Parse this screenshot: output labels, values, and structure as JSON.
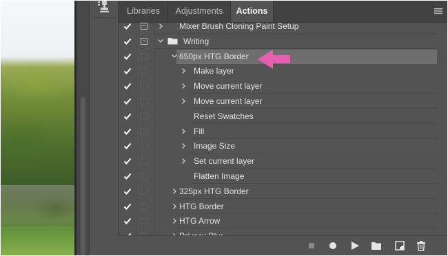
{
  "colors": {
    "panel_bg": "#535353",
    "tab_bar_bg": "#424242",
    "selected_row_bg": "#6e6e6e",
    "annotation_arrow": "#e55fae",
    "text": "#e2e2e2"
  },
  "tabs": [
    {
      "label": "Libraries",
      "active": false
    },
    {
      "label": "Adjustments",
      "active": false
    },
    {
      "label": "Actions",
      "active": true
    }
  ],
  "actions": [
    {
      "label": "Mixer Brush Cloning Paint Setup",
      "level": 0,
      "expander": "collapsed",
      "checked": true,
      "dialog": true
    },
    {
      "label": "Writing",
      "level": 0,
      "expander": "expanded",
      "folder": true,
      "checked": true,
      "dialog": true
    },
    {
      "label": "650px HTG Border",
      "level": 1,
      "expander": "expanded",
      "checked": true,
      "dialog": false,
      "selected": true
    },
    {
      "label": "Make layer",
      "level": 2,
      "expander": "collapsed",
      "checked": true,
      "dialog": false
    },
    {
      "label": "Move current layer",
      "level": 2,
      "expander": "collapsed",
      "checked": true,
      "dialog": false
    },
    {
      "label": "Move current layer",
      "level": 2,
      "expander": "collapsed",
      "checked": true,
      "dialog": false
    },
    {
      "label": "Reset Swatches",
      "level": 2,
      "expander": "none",
      "checked": true,
      "dialog": false
    },
    {
      "label": "Fill",
      "level": 2,
      "expander": "collapsed",
      "checked": true,
      "dialog": false
    },
    {
      "label": "Image Size",
      "level": 2,
      "expander": "collapsed",
      "checked": true,
      "dialog": false
    },
    {
      "label": "Set current layer",
      "level": 2,
      "expander": "collapsed",
      "checked": true,
      "dialog": false
    },
    {
      "label": "Flatten Image",
      "level": 2,
      "expander": "none",
      "checked": true,
      "dialog": false
    },
    {
      "label": "325px HTG Border",
      "level": 1,
      "expander": "collapsed",
      "checked": true,
      "dialog": false
    },
    {
      "label": "HTG Border",
      "level": 1,
      "expander": "collapsed",
      "checked": true,
      "dialog": false
    },
    {
      "label": "HTG Arrow",
      "level": 1,
      "expander": "collapsed",
      "checked": true,
      "dialog": false
    },
    {
      "label": "Privacy Blur",
      "level": 1,
      "expander": "collapsed",
      "checked": true,
      "dialog": false
    }
  ],
  "footer_buttons": [
    {
      "name": "stop-recording-icon",
      "icon": "stop"
    },
    {
      "name": "begin-recording-icon",
      "icon": "record"
    },
    {
      "name": "play-selection-icon",
      "icon": "play"
    },
    {
      "name": "new-set-icon",
      "icon": "folder"
    },
    {
      "name": "new-action-icon",
      "icon": "new-page"
    },
    {
      "name": "delete-icon",
      "icon": "trash"
    }
  ]
}
